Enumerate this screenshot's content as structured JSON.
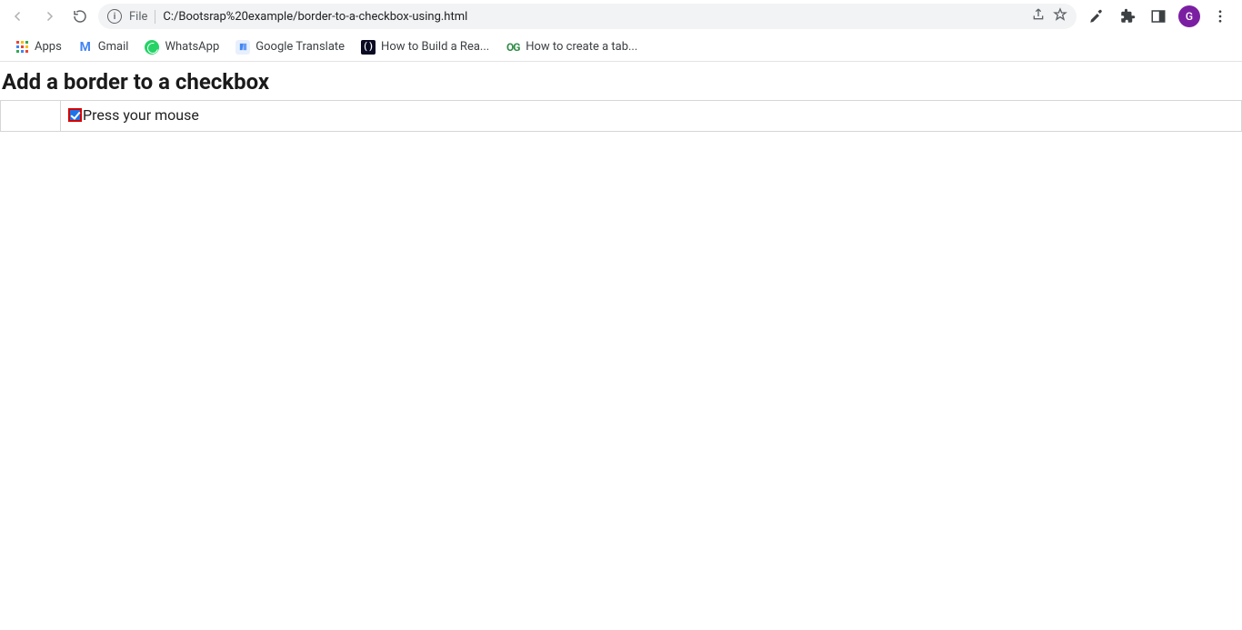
{
  "toolbar": {
    "file_chip": "File",
    "url": "C:/Bootsrap%20example/border-to-a-checkbox-using.html"
  },
  "avatar_initial": "G",
  "bookmarks": {
    "apps": "Apps",
    "gmail": "Gmail",
    "whatsapp": "WhatsApp",
    "google_translate": "Google Translate",
    "fcc": "How to Build a Rea...",
    "gfg": "How to create a tab..."
  },
  "page": {
    "heading": "Add a border to a checkbox",
    "checkbox_label": "Press your mouse"
  }
}
